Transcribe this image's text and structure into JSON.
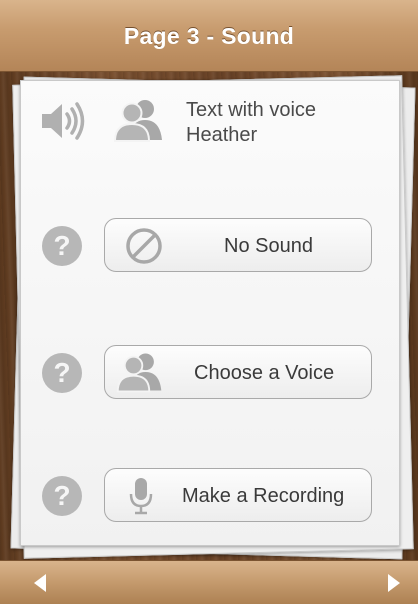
{
  "header": {
    "title": "Page 3 - Sound"
  },
  "current_sound": {
    "line1": "Text with voice",
    "line2": "Heather",
    "icons": [
      "speaker-icon",
      "people-icon"
    ]
  },
  "options": {
    "no_sound": {
      "label": "No Sound",
      "icon": "no-symbol-icon"
    },
    "choose_voice": {
      "label": "Choose a Voice",
      "icon": "people-icon"
    },
    "make_recording": {
      "label": "Make a Recording",
      "icon": "microphone-icon"
    },
    "help_glyph": "?"
  },
  "nav": {
    "prev_icon": "left-arrow-icon",
    "next_icon": "right-arrow-icon"
  },
  "colors": {
    "bar": "#c89c6f",
    "wood": "#6b4528",
    "paper": "#f4f4f4",
    "icon_gray": "#b0b0b0"
  }
}
